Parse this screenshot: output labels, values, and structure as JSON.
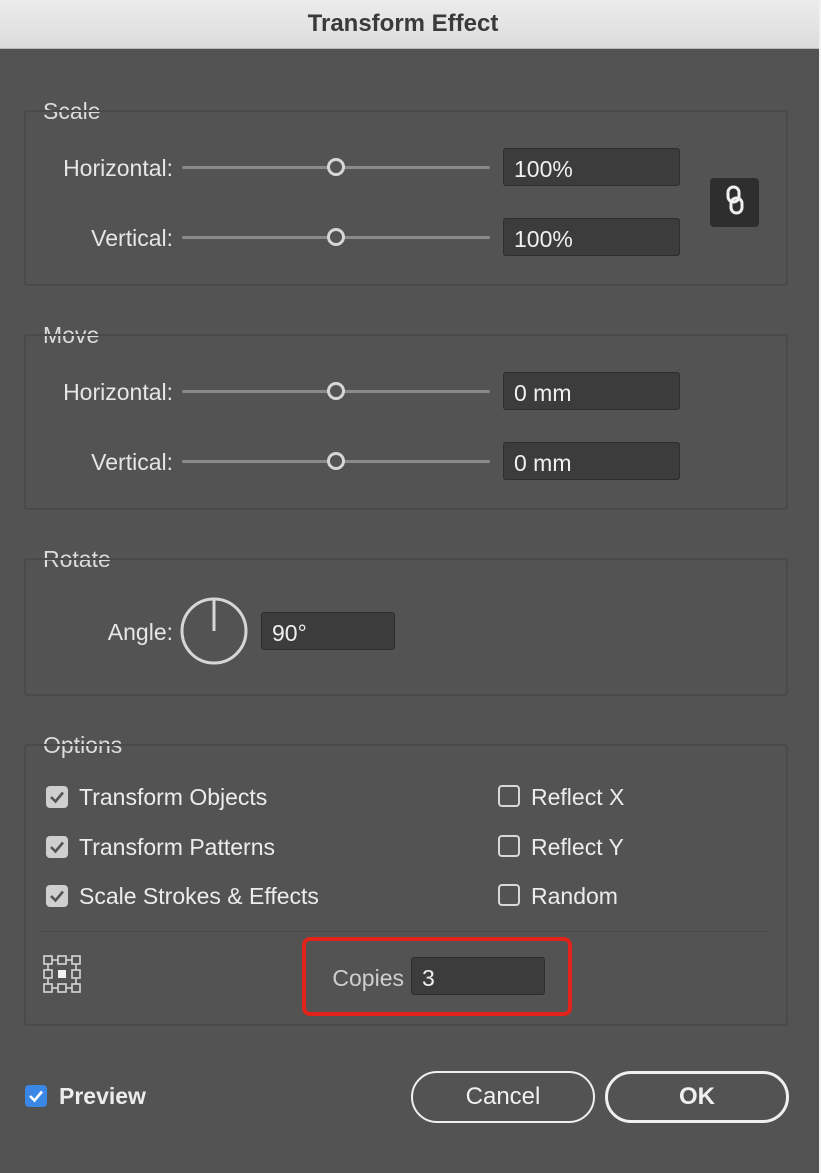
{
  "window": {
    "title": "Transform Effect"
  },
  "scale": {
    "label": "Scale",
    "horizontal_label": "Horizontal:",
    "horizontal_value": "100%",
    "vertical_label": "Vertical:",
    "vertical_value": "100%",
    "link_icon": "link-icon"
  },
  "move": {
    "label": "Move",
    "horizontal_label": "Horizontal:",
    "horizontal_value": "0 mm",
    "vertical_label": "Vertical:",
    "vertical_value": "0 mm"
  },
  "rotate": {
    "label": "Rotate",
    "angle_label": "Angle:",
    "angle_value": "90°"
  },
  "options": {
    "label": "Options",
    "transform_objects": {
      "label": "Transform Objects",
      "checked": true
    },
    "transform_patterns": {
      "label": "Transform Patterns",
      "checked": true
    },
    "scale_strokes": {
      "label": "Scale Strokes & Effects",
      "checked": true
    },
    "reflect_x": {
      "label": "Reflect X",
      "checked": false
    },
    "reflect_y": {
      "label": "Reflect Y",
      "checked": false
    },
    "random": {
      "label": "Random",
      "checked": false
    },
    "copies_label": "Copies",
    "copies_value": "3"
  },
  "footer": {
    "preview_label": "Preview",
    "preview_checked": true,
    "cancel_label": "Cancel",
    "ok_label": "OK"
  },
  "colors": {
    "highlight": "#e2231a",
    "preview_check": "#3b87e6"
  }
}
